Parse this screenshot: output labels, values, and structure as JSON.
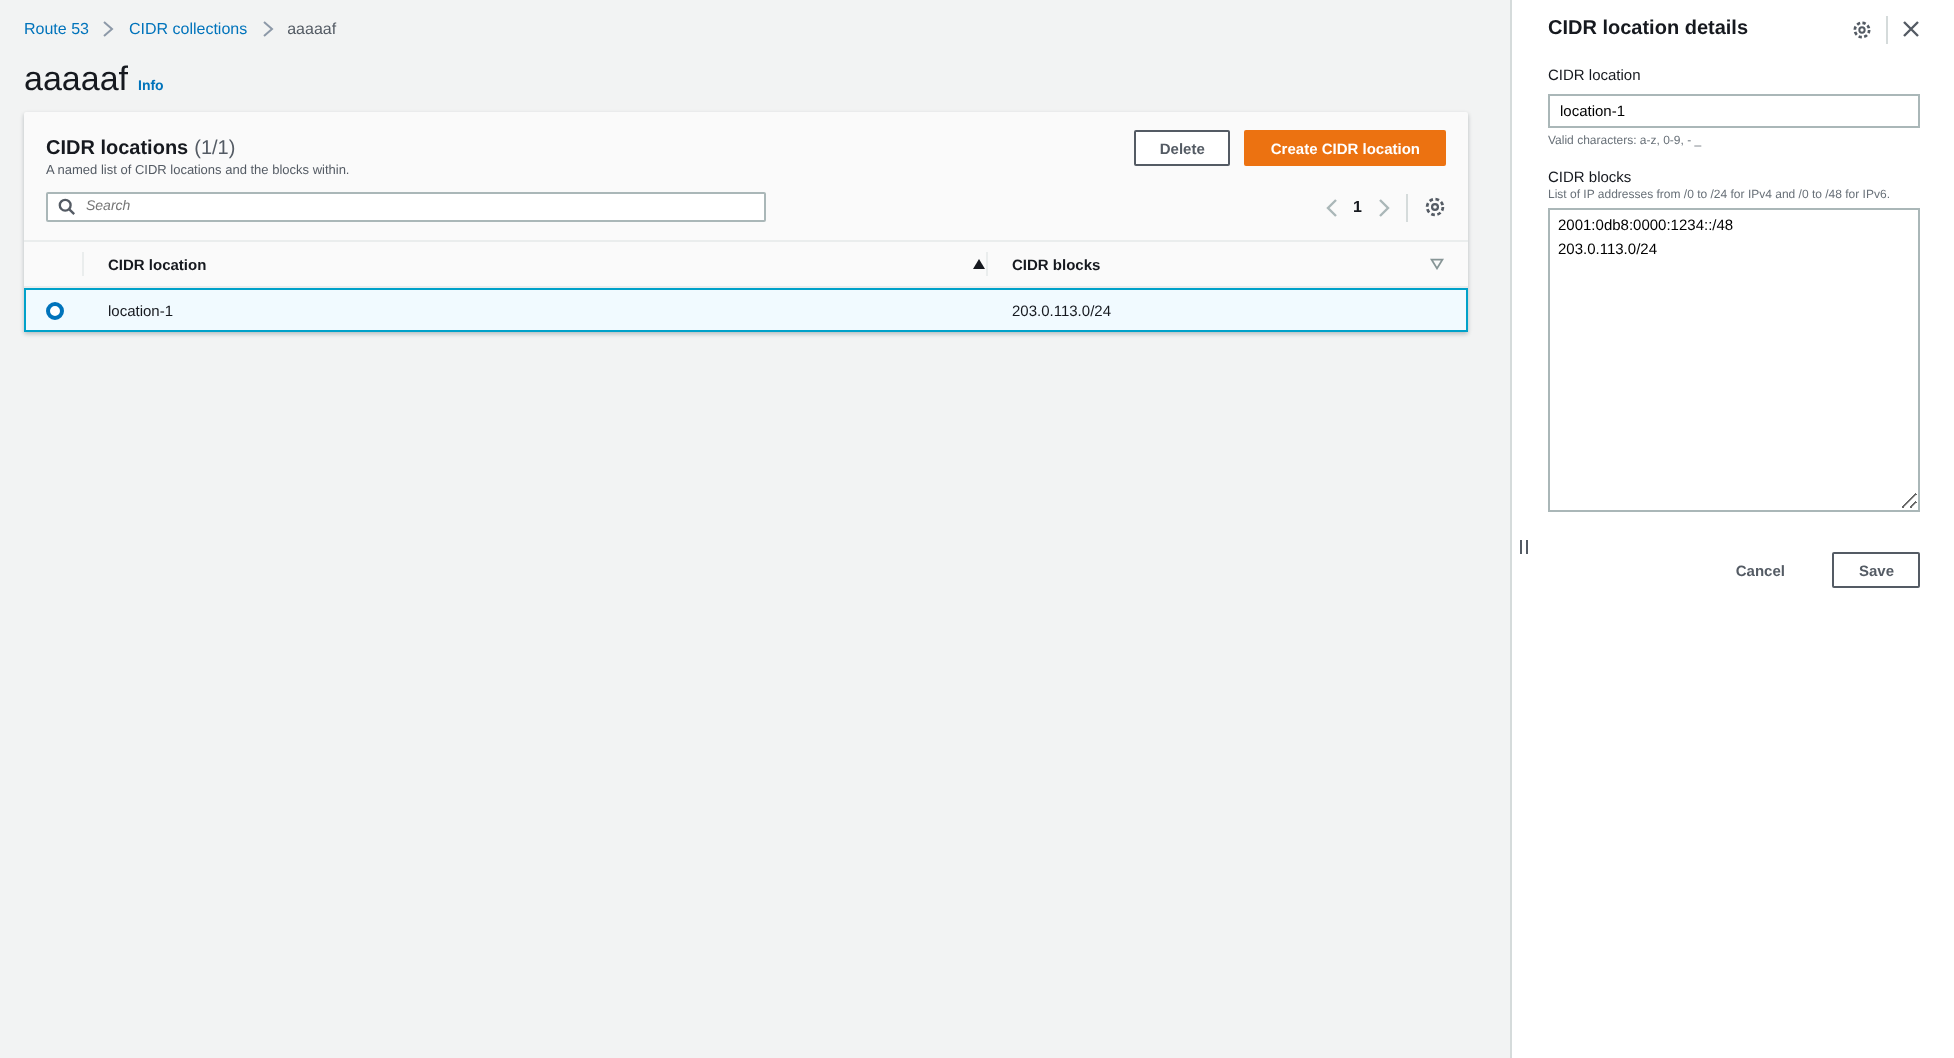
{
  "breadcrumbs": [
    {
      "label": "Route 53",
      "link": true
    },
    {
      "label": "CIDR collections",
      "link": true
    },
    {
      "label": "aaaaaf",
      "link": false
    }
  ],
  "page": {
    "title": "aaaaaf",
    "info": "Info"
  },
  "table": {
    "title": "CIDR locations",
    "count": "(1/1)",
    "description": "A named list of CIDR locations and the blocks within.",
    "buttons": [
      {
        "label": "Delete",
        "kind": "secondary"
      },
      {
        "label": "Create CIDR location",
        "kind": "primary"
      }
    ],
    "search": {
      "placeholder": "Search"
    },
    "page_number": "1",
    "columns": [
      {
        "label": "CIDR location",
        "sorted": true
      },
      {
        "label": "CIDR blocks",
        "sorted": false
      }
    ],
    "rows": [
      {
        "selected": true,
        "cells": [
          "location-1",
          "203.0.113.0/24"
        ]
      }
    ]
  },
  "panel": {
    "title": "CIDR location details",
    "location": {
      "label": "CIDR location",
      "value": "location-1",
      "hint": "Valid characters: a-z, 0-9, - _"
    },
    "blocks": {
      "label": "CIDR blocks",
      "description": "List of IP addresses from /0 to /24 for IPv4 and /0 to /48 for IPv6.",
      "value": "2001:0db8:0000:1234::/48\n203.0.113.0/24"
    },
    "buttons": [
      {
        "label": "Cancel",
        "kind": "link"
      },
      {
        "label": "Save",
        "kind": "secondary"
      }
    ]
  }
}
